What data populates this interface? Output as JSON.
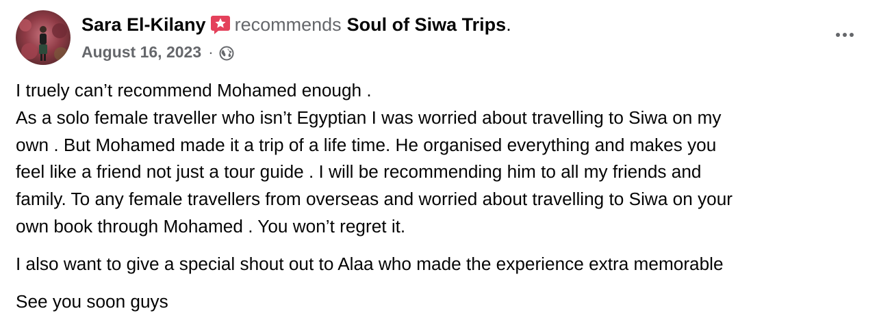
{
  "post": {
    "author_name": "Sara El-Kilany",
    "recommends_word": "recommends",
    "page_name": "Soul of Siwa Trips",
    "period": ".",
    "date": "August 16, 2023",
    "separator": "·",
    "privacy_icon": "globe-icon",
    "recommendation_icon": "recommendation-star-icon",
    "more_icon": "more-options-icon",
    "badge_color": "#e4415b",
    "body": {
      "paragraph1_lines": [
        "I truely can’t recommend Mohamed enough .",
        "As a solo female traveller who isn’t Egyptian I was worried about travelling to Siwa on my",
        "own . But Mohamed made it a trip of a life time. He organised everything and makes you",
        "feel like a friend not just a tour guide . I will be recommending him to all my friends and",
        "family. To any female travellers from overseas and worried about travelling to Siwa on your",
        "own book through Mohamed . You won’t regret it."
      ],
      "paragraph2": "I also want to give a special shout out to Alaa who made the experience extra memorable",
      "paragraph3": "See you soon guys"
    }
  }
}
